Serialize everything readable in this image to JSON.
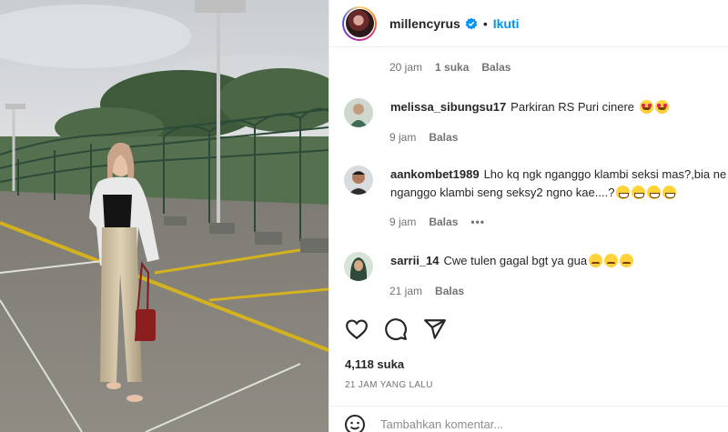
{
  "post": {
    "username": "millencyrus",
    "follow_label": "Ikuti",
    "separator": "•"
  },
  "top_meta": {
    "time": "20 jam",
    "likes": "1 suka",
    "reply": "Balas"
  },
  "comments": [
    {
      "user": "melissa_sibungsu17",
      "text": "Parkiran RS Puri cinere",
      "emojis": [
        "star-struck",
        "star-struck"
      ],
      "time": "9 jam",
      "reply": "Balas"
    },
    {
      "user": "aankombet1989",
      "text": "Lho kq ngk nganggo klambi seksi mas?,bia ne nganggo klambi seng seksy2 ngno kae....?",
      "emojis": [
        "grinning-squinting",
        "grinning-squinting",
        "grinning-squinting",
        "grinning-squinting"
      ],
      "time": "9 jam",
      "reply": "Balas",
      "more": "•••"
    },
    {
      "user": "sarrii_14",
      "text": "Cwe tulen gagal bgt ya gua",
      "emojis": [
        "frowning",
        "frowning",
        "frowning"
      ],
      "time": "21 jam",
      "reply": "Balas"
    }
  ],
  "actions": {
    "like_icon": "heart-icon",
    "comment_icon": "comment-icon",
    "share_icon": "send-icon"
  },
  "likes_count": "4,118 suka",
  "posted_time": "21 JAM YANG LALU",
  "add_comment": {
    "placeholder": "Tambahkan komentar..."
  },
  "colors": {
    "accent": "#0095f6",
    "text": "#262626",
    "muted": "#737373"
  }
}
